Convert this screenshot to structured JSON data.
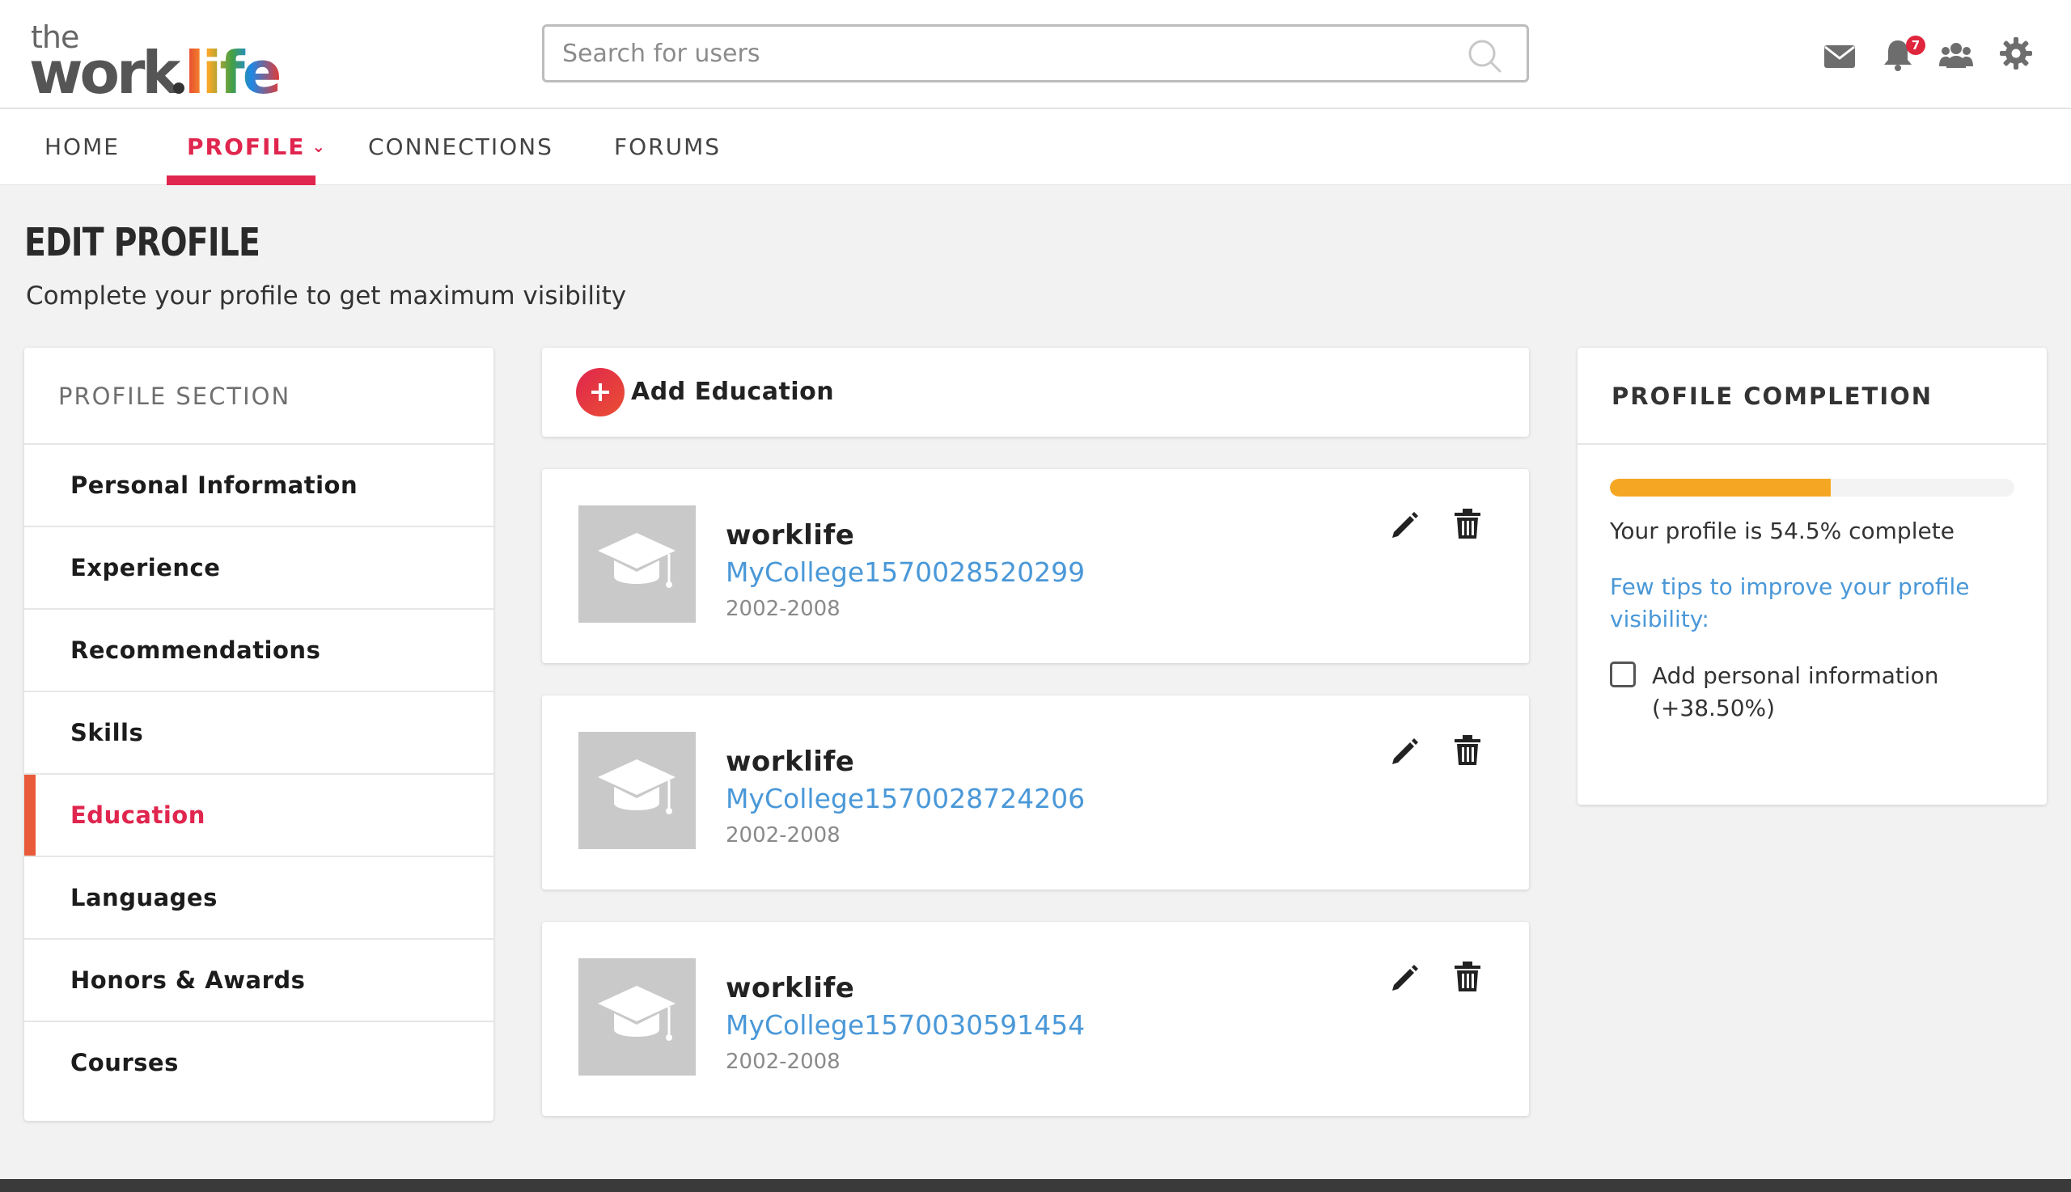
{
  "brand": {
    "logo_the": "the",
    "logo_work": "work",
    "logo_life": "life"
  },
  "search": {
    "placeholder": "Search for users",
    "value": ""
  },
  "header": {
    "icons": [
      "mail-icon",
      "bell-icon",
      "people-icon",
      "gear-icon"
    ],
    "notification_count": "7"
  },
  "nav": {
    "items": [
      {
        "label": "HOME"
      },
      {
        "label": "PROFILE",
        "active": true
      },
      {
        "label": "CONNECTIONS"
      },
      {
        "label": "FORUMS"
      }
    ],
    "profile_chevron": "⌄"
  },
  "page": {
    "title": "EDIT PROFILE",
    "subtitle": "Complete your profile to get maximum visibility"
  },
  "profile_section": {
    "heading": "PROFILE SECTION",
    "items": [
      {
        "label": "Personal Information"
      },
      {
        "label": "Experience"
      },
      {
        "label": "Recommendations"
      },
      {
        "label": "Skills"
      },
      {
        "label": "Education",
        "active": true
      },
      {
        "label": "Languages"
      },
      {
        "label": "Honors & Awards"
      },
      {
        "label": "Courses"
      }
    ]
  },
  "education": {
    "add_label": "Add Education",
    "entries": [
      {
        "name": "worklife",
        "college": "MyCollege1570028520299",
        "years": "2002-2008"
      },
      {
        "name": "worklife",
        "college": "MyCollege1570028724206",
        "years": "2002-2008"
      },
      {
        "name": "worklife",
        "college": "MyCollege1570030591454",
        "years": "2002-2008"
      }
    ]
  },
  "completion": {
    "heading": "PROFILE COMPLETION",
    "progress_percent": 54.5,
    "status_text": "Your profile is 54.5% complete",
    "tips_link": "Few tips to improve your profile visibility:",
    "tips": [
      {
        "label": "Add personal information (+38.50%)",
        "checked": false
      }
    ]
  },
  "colors": {
    "accent": "#e0264e",
    "link": "#4a98d8",
    "progress": "#f5a623",
    "active_marker": "#e85a3a"
  }
}
